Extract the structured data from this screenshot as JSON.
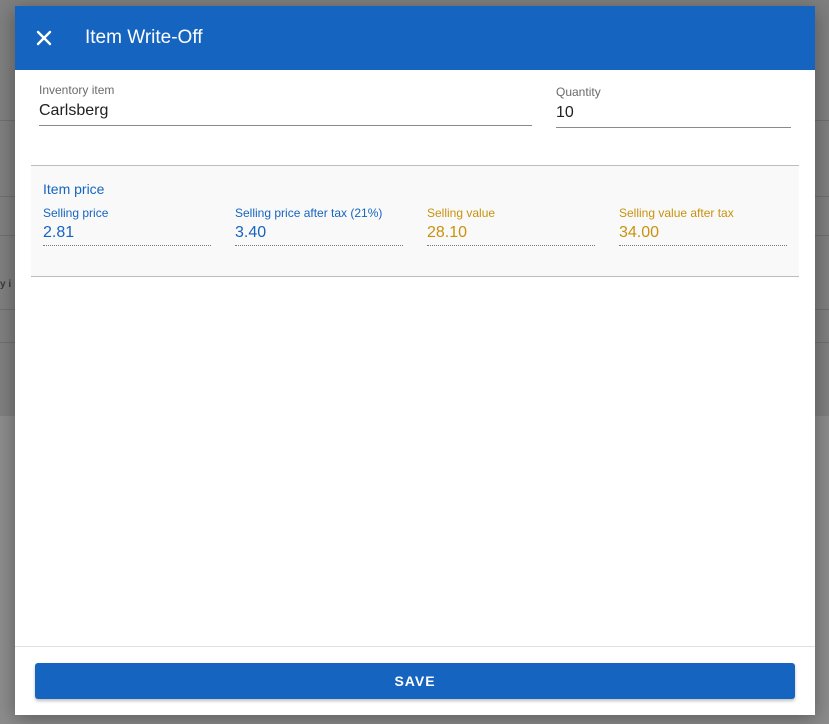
{
  "dialog": {
    "title": "Item Write-Off",
    "close_icon": "close-icon"
  },
  "form": {
    "inventory_item": {
      "label": "Inventory item",
      "value": "Carlsberg"
    },
    "quantity": {
      "label": "Quantity",
      "value": "10"
    }
  },
  "price": {
    "title": "Item price",
    "fields": [
      {
        "label": "Selling price",
        "value": "2.81"
      },
      {
        "label": "Selling price after tax (21%)",
        "value": "3.40"
      },
      {
        "label": "Selling value",
        "value": "28.10"
      },
      {
        "label": "Selling value after tax",
        "value": "34.00"
      }
    ]
  },
  "footer": {
    "save_label": "SAVE"
  },
  "background": {
    "partial_text": "y i"
  },
  "colors": {
    "primary": "#1565c0",
    "value_gold": "#c9920e"
  }
}
